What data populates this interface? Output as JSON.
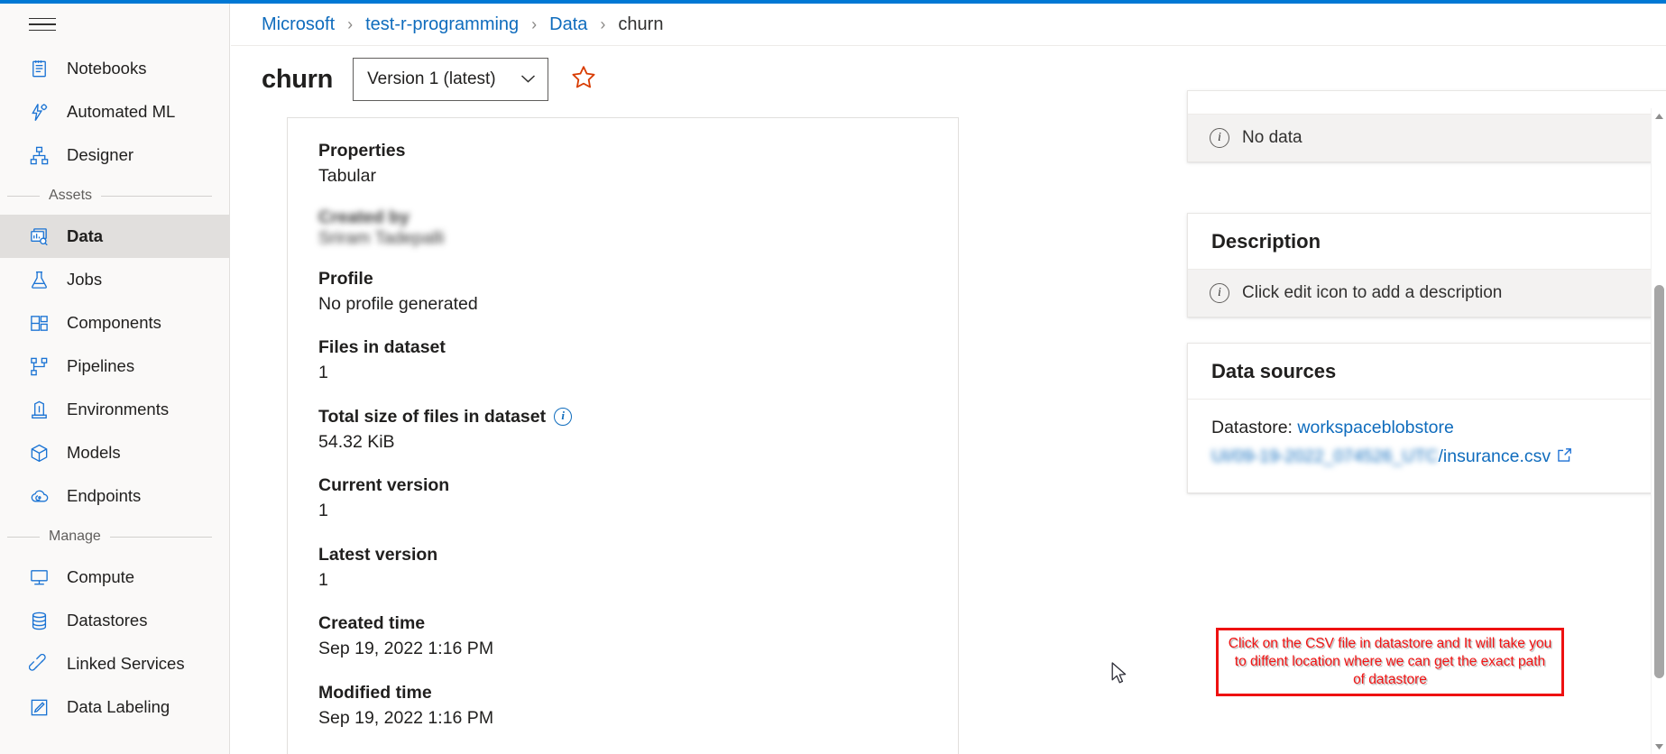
{
  "brand": {
    "accent": "#0078d4",
    "link": "#0f6cbd",
    "annotation": "#f01414"
  },
  "sidebar": {
    "hamburger_label": "global-nav-toggle",
    "items": [
      {
        "label": "Notebooks",
        "icon": "notebook-icon",
        "active": false
      },
      {
        "label": "Automated ML",
        "icon": "automated-ml-icon",
        "active": false
      },
      {
        "label": "Designer",
        "icon": "designer-icon",
        "active": false
      }
    ],
    "group_assets": "Assets",
    "asset_items": [
      {
        "label": "Data",
        "icon": "data-icon",
        "active": true
      },
      {
        "label": "Jobs",
        "icon": "jobs-flask-icon",
        "active": false
      },
      {
        "label": "Components",
        "icon": "components-icon",
        "active": false
      },
      {
        "label": "Pipelines",
        "icon": "pipelines-icon",
        "active": false
      },
      {
        "label": "Environments",
        "icon": "environments-icon",
        "active": false
      },
      {
        "label": "Models",
        "icon": "models-cube-icon",
        "active": false
      },
      {
        "label": "Endpoints",
        "icon": "endpoints-cloud-icon",
        "active": false
      }
    ],
    "group_manage": "Manage",
    "manage_items": [
      {
        "label": "Compute",
        "icon": "compute-monitor-icon",
        "active": false
      },
      {
        "label": "Datastores",
        "icon": "datastores-database-icon",
        "active": false
      },
      {
        "label": "Linked Services",
        "icon": "linked-services-icon",
        "active": false
      },
      {
        "label": "Data Labeling",
        "icon": "data-labeling-icon",
        "active": false
      }
    ]
  },
  "breadcrumb": {
    "items": [
      {
        "label": "Microsoft",
        "is_last": false
      },
      {
        "label": "test-r-programming",
        "is_last": false
      },
      {
        "label": "Data",
        "is_last": false
      },
      {
        "label": "churn",
        "is_last": true
      }
    ],
    "separator": "›"
  },
  "header": {
    "title": "churn",
    "version_selected": "Version 1 (latest)",
    "version_caret": "chevron-down-icon",
    "favorite_icon": "star-outline-icon"
  },
  "properties_panel": {
    "heading": "Properties",
    "heading_value": "Tabular",
    "created_by_label": "Created by",
    "created_by_value": "Sriram Tadepalli",
    "rows": [
      {
        "label": "Profile",
        "value": "No profile generated",
        "info": false
      },
      {
        "label": "Files in dataset",
        "value": "1",
        "info": false
      },
      {
        "label": "Total size of files in dataset",
        "value": "54.32 KiB",
        "info": true
      },
      {
        "label": "Current version",
        "value": "1",
        "info": false
      },
      {
        "label": "Latest version",
        "value": "1",
        "info": false
      },
      {
        "label": "Created time",
        "value": "Sep 19, 2022 1:16 PM",
        "info": false
      },
      {
        "label": "Modified time",
        "value": "Sep 19, 2022 1:16 PM",
        "info": false
      }
    ]
  },
  "tags_card": {
    "empty_message": "No data",
    "info_icon": "info-circle-icon"
  },
  "description_card": {
    "title": "Description",
    "edit_icon": "pencil-edit-icon",
    "empty_message": "Click edit icon to add a description",
    "info_icon": "info-circle-icon"
  },
  "data_sources_card": {
    "title": "Data sources",
    "datastore_prefix": "Datastore: ",
    "datastore_name": "workspaceblobstore",
    "path_prefix_redacted": "UI/09-19-2022_074526_UTC",
    "path_file": "/insurance.csv",
    "external_icon": "external-link-icon"
  },
  "annotation": {
    "text": "Click on the CSV file in datastore and It will take you to diffent location where we can get the exact path of datastore"
  },
  "scrollbar": {
    "up_arrow": "scroll-up-arrow-icon",
    "down_arrow": "scroll-down-arrow-icon"
  }
}
